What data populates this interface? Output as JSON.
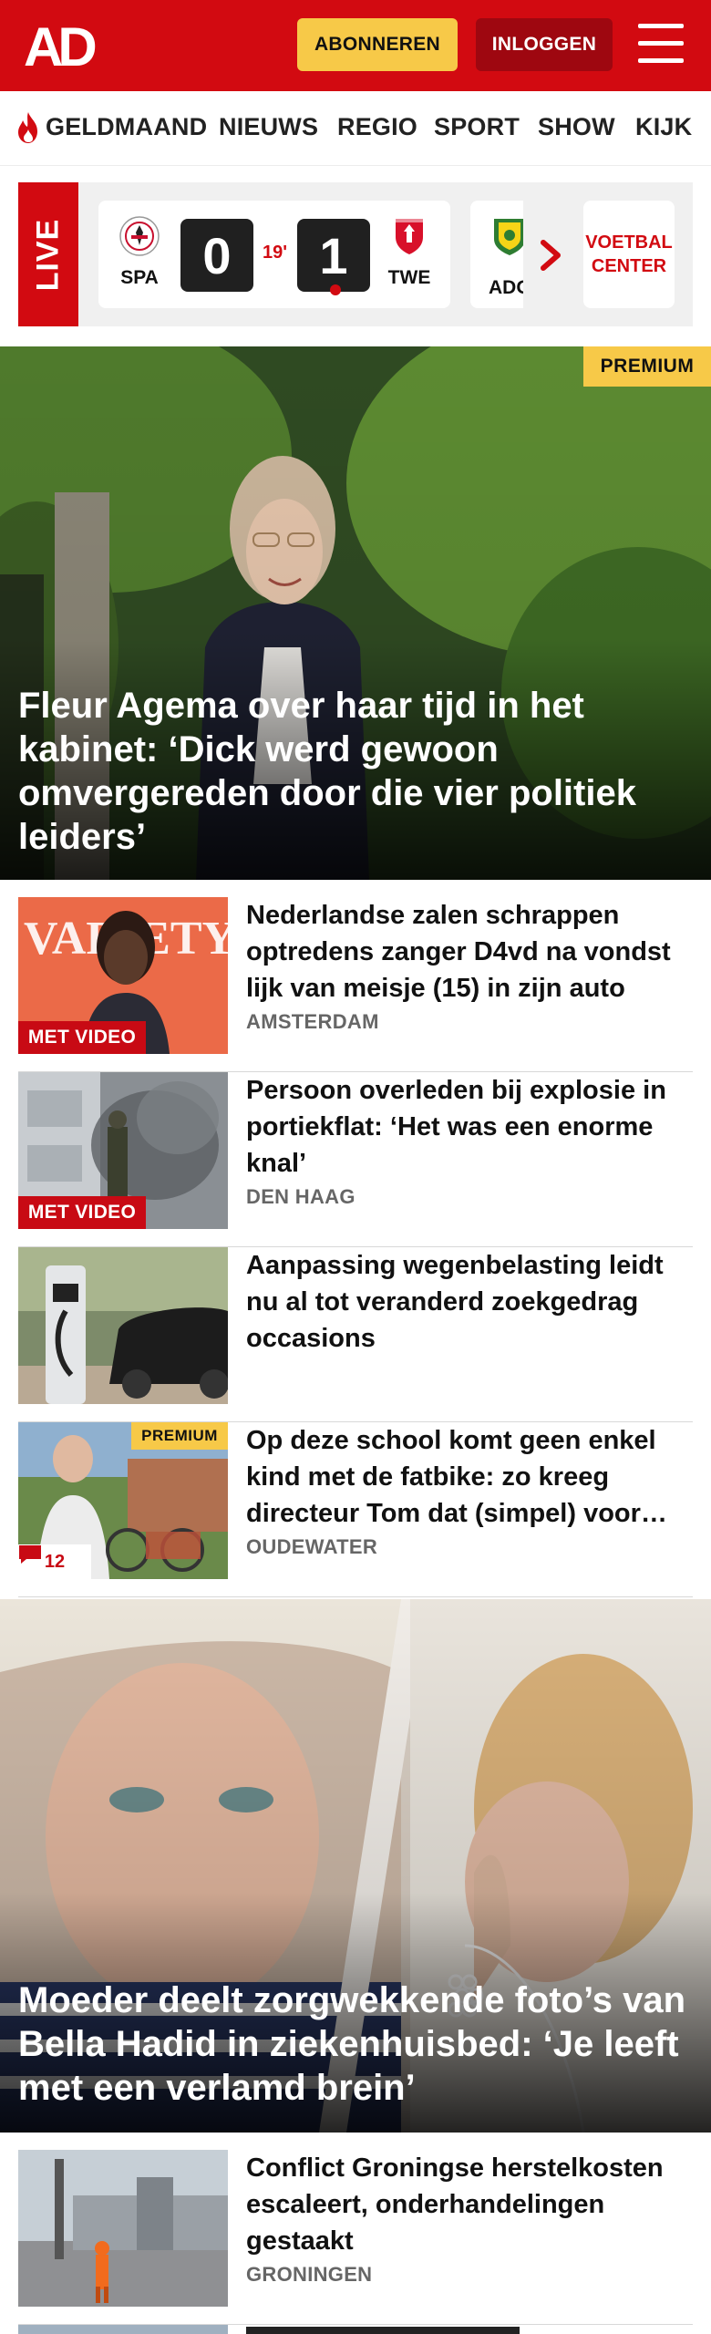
{
  "header": {
    "logo_text": "AD",
    "subscribe_label": "ABONNEREN",
    "login_label": "INLOGGEN",
    "menu_icon": "hamburger-menu-icon",
    "brand_color": "#d20a11"
  },
  "nav": {
    "items": [
      {
        "label": "GELDMAAND",
        "icon": "flame-icon"
      },
      {
        "label": "NIEUWS"
      },
      {
        "label": "REGIO"
      },
      {
        "label": "SPORT"
      },
      {
        "label": "SHOW"
      },
      {
        "label": "KIJK"
      }
    ]
  },
  "live": {
    "label": "LIVE",
    "match": {
      "home_team": "SPA",
      "home_score": "0",
      "minute": "19'",
      "away_score": "1",
      "away_team": "TWE"
    },
    "next_match_team": "ADO",
    "voetbal_center_line1": "VOETBAL",
    "voetbal_center_line2": "CENTER"
  },
  "hero": {
    "badge": "PREMIUM",
    "title": "Fleur Agema over haar tijd in het kabinet: ‘Dick werd gewoon omvergereden door die vier politiek leiders’"
  },
  "articles": [
    {
      "title": "Nederlandse zalen schrappen optredens zanger D4vd na vondst lijk van meisje (15) in zijn auto",
      "location": "AMSTERDAM",
      "badge": "MET VIDEO",
      "thumb_text": "VARIETY"
    },
    {
      "title": "Persoon overleden bij explosie in portiekflat: ‘Het was een enorme knal’",
      "location": "DEN HAAG",
      "badge": "MET VIDEO"
    },
    {
      "title": "Aanpassing wegenbelasting leidt nu al tot veranderd zoekgedrag occasions",
      "location": ""
    },
    {
      "title": "Op deze school komt geen enkel kind met de fatbike: zo kreeg directeur Tom dat (simpel) voor elkaar",
      "location": "OUDEWATER",
      "badge": "PREMIUM",
      "comments": "12"
    }
  ],
  "hero2": {
    "title": "Moeder deelt zorgwekkende foto’s van Bella Hadid in ziekenhuisbed: ‘Je leeft met een verlamd brein’"
  },
  "articles2": [
    {
      "title": "Conflict Groningse herstelkosten escaleert, onderhandelingen gestaakt",
      "location": "GRONINGEN"
    }
  ]
}
